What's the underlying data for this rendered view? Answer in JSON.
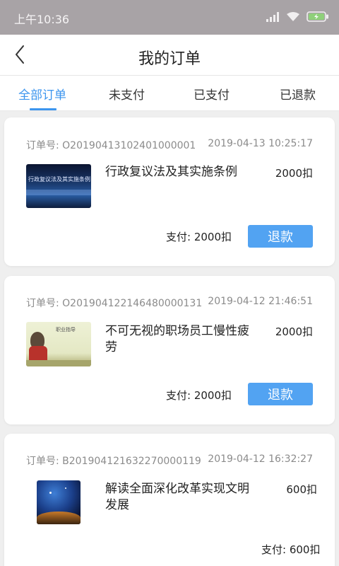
{
  "status_bar": {
    "time": "上午10:36",
    "icons": [
      "signal-icon",
      "wifi-icon",
      "battery-icon"
    ]
  },
  "nav": {
    "back_icon": "back-chevron-icon",
    "title": "我的订单"
  },
  "tabs": [
    {
      "label": "全部订单",
      "active": true
    },
    {
      "label": "未支付",
      "active": false
    },
    {
      "label": "已支付",
      "active": false
    },
    {
      "label": "已退款",
      "active": false
    }
  ],
  "orders": [
    {
      "order_no": "订单号: O20190413102401000001",
      "time": "2019-04-13 10:25:17",
      "title": "行政复议法及其实施条例",
      "price": "2000扣",
      "paid": "支付: 2000扣",
      "refund_label": "退款",
      "thumb_text": "行政复议法及其实施条例"
    },
    {
      "order_no": "订单号: O20190412214648000013​1",
      "time": "2019-04-12 21:46:51",
      "title": "不可无视的职场员工慢性疲劳",
      "price": "2000扣",
      "paid": "支付: 2000扣",
      "refund_label": "退款",
      "thumb_text": "职业指导"
    },
    {
      "order_no": "订单号: B20190412163227000011​9",
      "time": "2019-04-12 16:32:27",
      "title": "解读全面深化改革实现文明发展",
      "price": "600扣",
      "paid": "支付: 600扣"
    }
  ],
  "colors": {
    "accent": "#3c95ee",
    "button": "#52a3f2",
    "status_bar": "#a8a3a6"
  }
}
